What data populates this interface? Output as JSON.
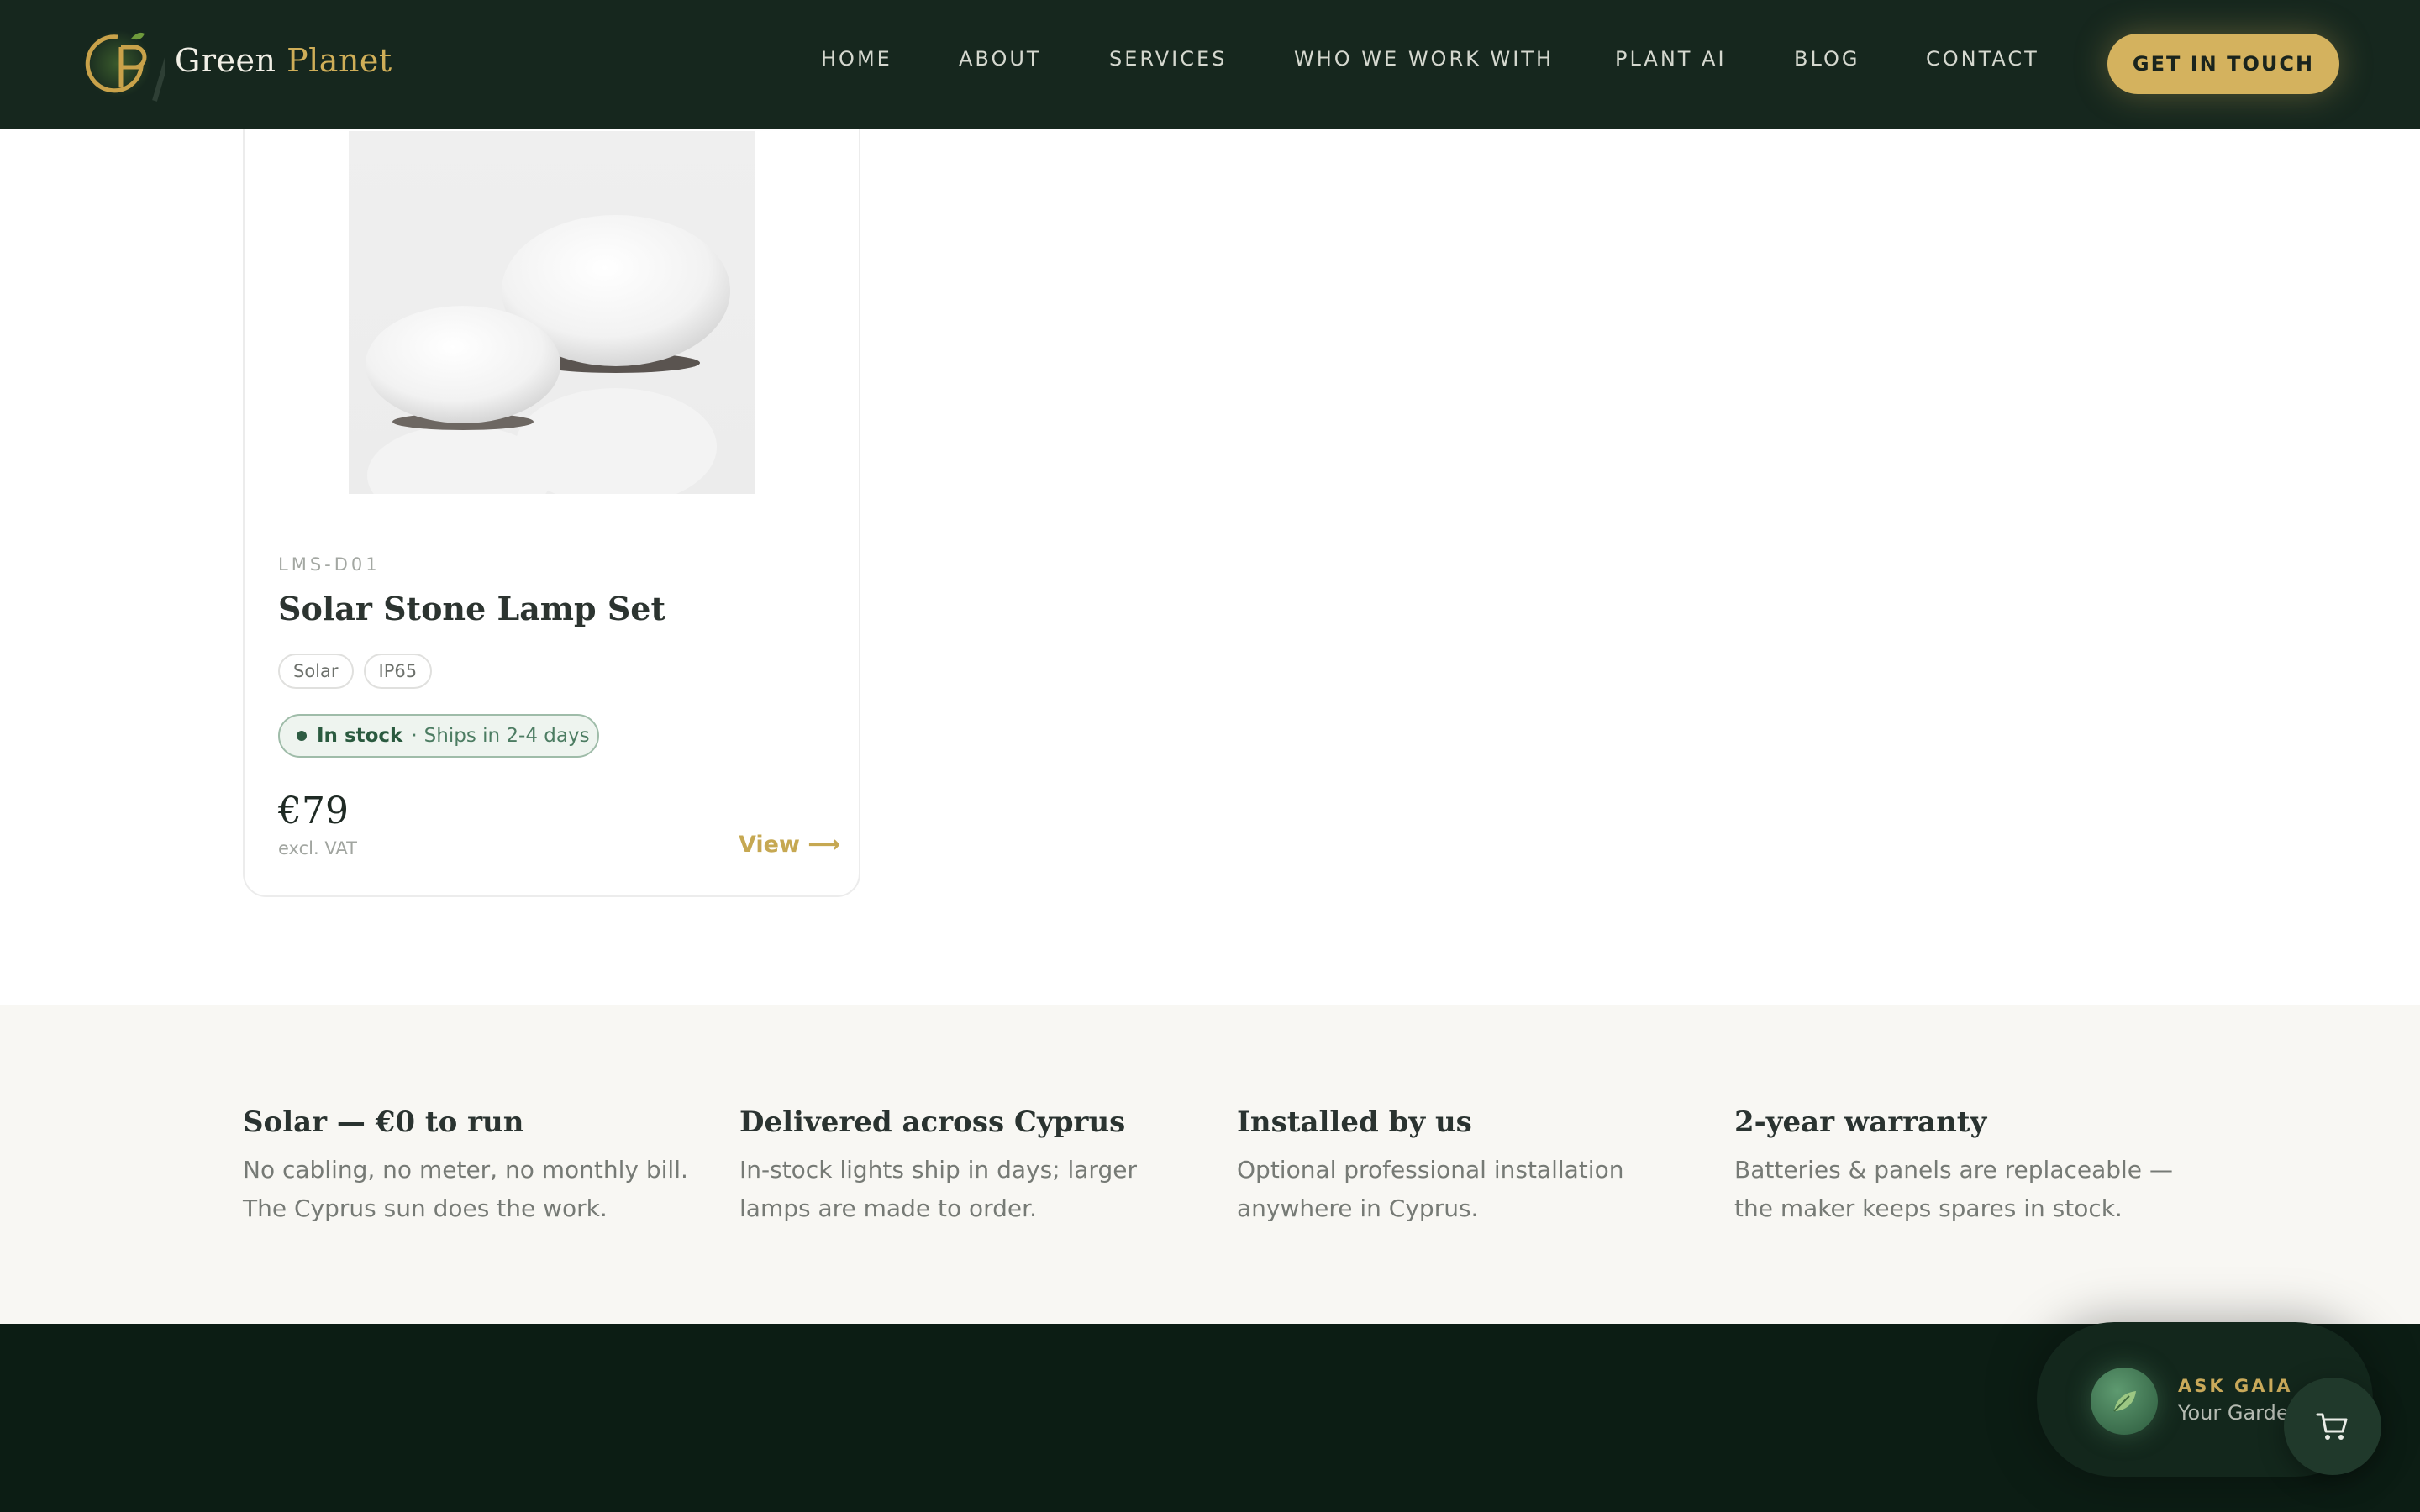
{
  "header": {
    "brand_green": "Green",
    "brand_planet": "Planet",
    "nav": [
      {
        "label": "HOME"
      },
      {
        "label": "ABOUT"
      },
      {
        "label": "SERVICES"
      },
      {
        "label": "WHO WE WORK WITH"
      },
      {
        "label": "PLANT AI"
      },
      {
        "label": "BLOG"
      },
      {
        "label": "CONTACT"
      }
    ],
    "cta": "GET IN TOUCH"
  },
  "product": {
    "sku": "LMS-D01",
    "name": "Solar Stone Lamp Set",
    "tags": [
      "Solar",
      "IP65"
    ],
    "stock_label": "In stock",
    "stock_separator": "·",
    "shipping": "Ships in 2-4 days",
    "price": "€79",
    "vat_note": "excl. VAT",
    "view_label": "View ⟶"
  },
  "features": [
    {
      "title": "Solar — €0 to run",
      "text": "No cabling, no meter, no monthly bill. The Cyprus sun does the work."
    },
    {
      "title": "Delivered across Cyprus",
      "text": "In-stock lights ship in days; larger lamps are made to order."
    },
    {
      "title": "Installed by us",
      "text": "Optional professional installation anywhere in Cyprus."
    },
    {
      "title": "2-year warranty",
      "text": "Batteries & panels are replaceable — the maker keeps spares in stock."
    }
  ],
  "assistant": {
    "eyebrow": "ASK GAIA",
    "subtitle": "Your Garden"
  },
  "icons": {
    "logo": "gp-monogram-icon",
    "assistant_avatar": "leaf-icon",
    "cart": "shopping-cart-icon"
  },
  "colors": {
    "header_bg": "#16271e",
    "accent_gold": "#d4b25e",
    "footer_bg": "#0c1d14",
    "feature_band_bg": "#f8f7f3",
    "stock_green": "#2a5a3f"
  }
}
